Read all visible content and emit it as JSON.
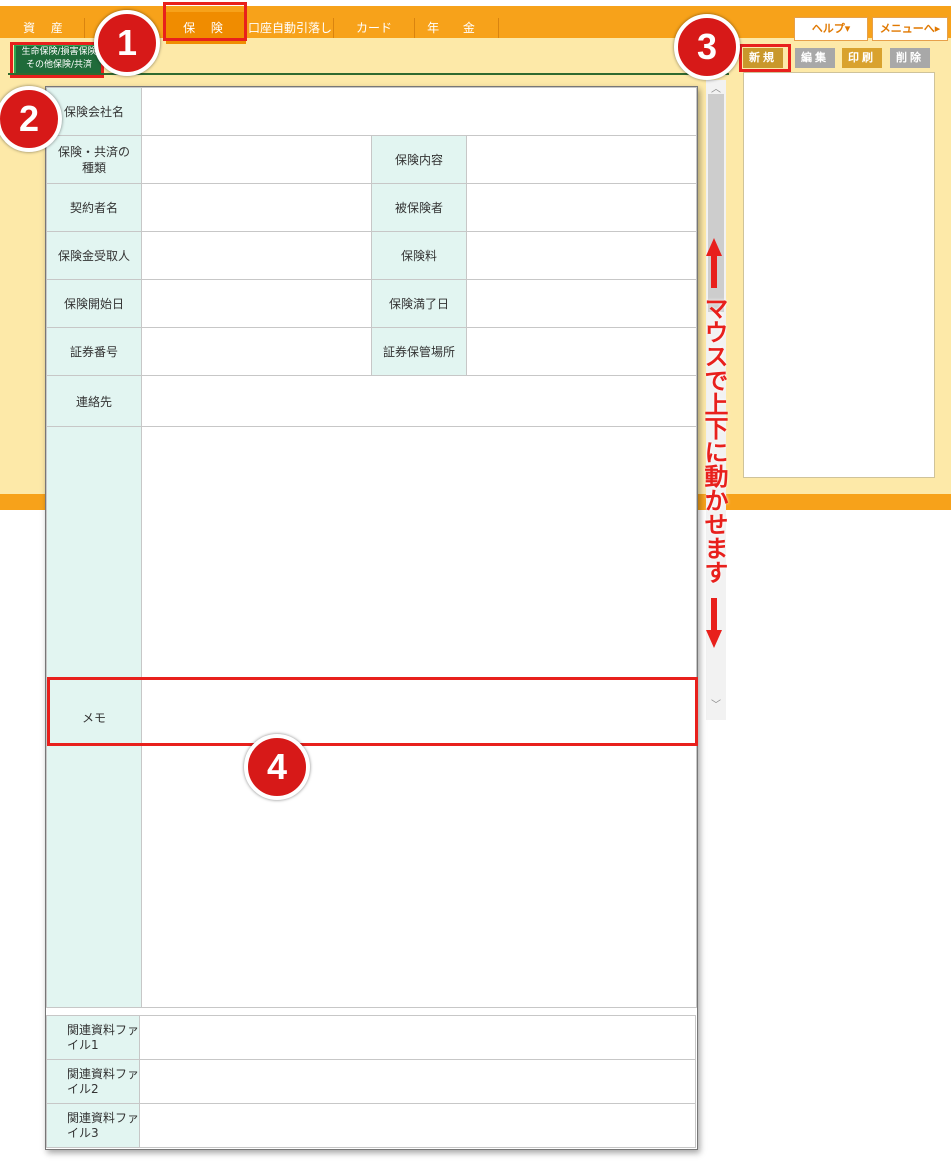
{
  "nav": {
    "tabs": [
      "資 産",
      "",
      "保 険",
      "口座自動引落し",
      "カード",
      "年 金"
    ],
    "help": "ヘルプ▾",
    "menu": "メニューへ▸"
  },
  "category_button": {
    "line1": "生命保険/損害保険",
    "line2": "その他保険/共済"
  },
  "actions": {
    "new": "新規",
    "edit": "編集",
    "print": "印刷",
    "delete": "削除"
  },
  "form": {
    "company": "保険会社名",
    "kind": "保険・共済の種類",
    "content": "保険内容",
    "contractor": "契約者名",
    "insured": "被保険者",
    "beneficiary": "保険金受取人",
    "premium": "保険料",
    "start": "保険開始日",
    "maturity": "保険満了日",
    "policy_no": "証券番号",
    "policy_place": "証券保管場所",
    "contact": "連絡先",
    "memo": "メモ",
    "files": [
      "関連資料ファイル1",
      "関連資料ファイル2",
      "関連資料ファイル3"
    ]
  },
  "annotation": {
    "scroll_hint": "マウスで上下に動かせます"
  },
  "markers": [
    "1",
    "2",
    "3",
    "4"
  ],
  "colors": {
    "nav": "#f7a21a",
    "highlight": "#e8201c",
    "label_bg": "#e2f5f1",
    "marker": "#d71918"
  }
}
